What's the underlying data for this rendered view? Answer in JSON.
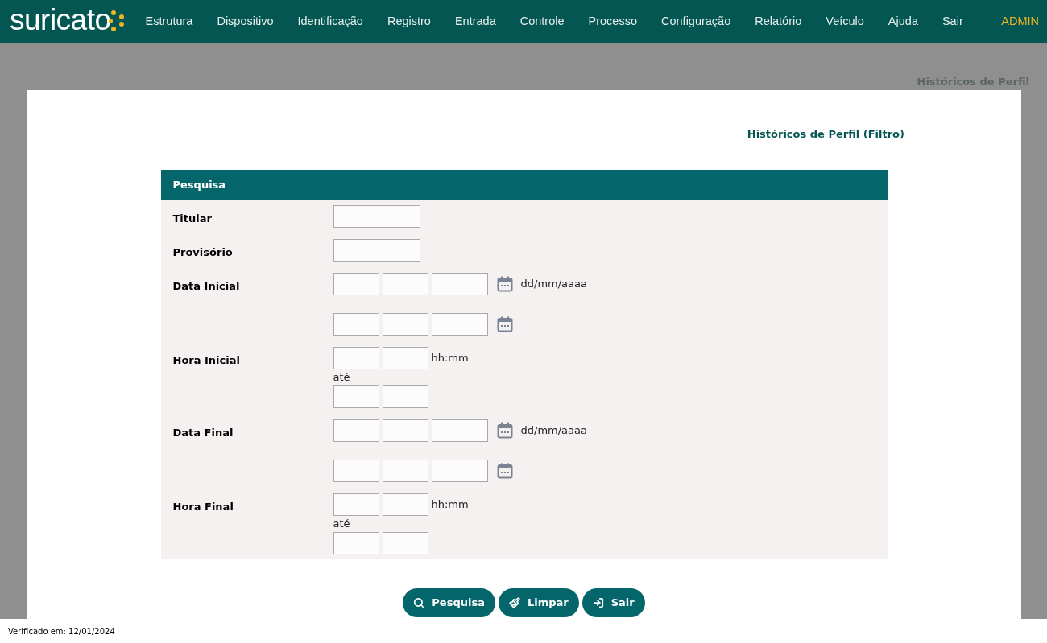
{
  "header": {
    "logo": "suricato",
    "nav": [
      "Estrutura",
      "Dispositivo",
      "Identificação",
      "Registro",
      "Entrada",
      "Controle",
      "Processo",
      "Configuração",
      "Relatório",
      "Veículo",
      "Ajuda",
      "Sair"
    ],
    "user": "ADMIN"
  },
  "breadcrumb": "Históricos de Perfil",
  "page_title": "Históricos de Perfil (Filtro)",
  "form": {
    "title": "Pesquisa",
    "fields": [
      {
        "label": "Titular",
        "kind": "text"
      },
      {
        "label": "Provisório",
        "kind": "text"
      },
      {
        "label": "Data Inicial",
        "kind": "date",
        "hint": "dd/mm/aaaa"
      },
      {
        "label": "Hora Inicial",
        "kind": "time",
        "hint": "hh:mm",
        "separator": "até"
      },
      {
        "label": "Data Final",
        "kind": "date",
        "hint": "dd/mm/aaaa"
      },
      {
        "label": "Hora Final",
        "kind": "time",
        "hint": "hh:mm",
        "separator": "até"
      }
    ]
  },
  "buttons": [
    {
      "label": "Pesquisa",
      "kind": "search"
    },
    {
      "label": "Limpar",
      "kind": "clear"
    },
    {
      "label": "Sair",
      "kind": "exit"
    }
  ],
  "footer": "Verificado em: 12/01/2024"
}
